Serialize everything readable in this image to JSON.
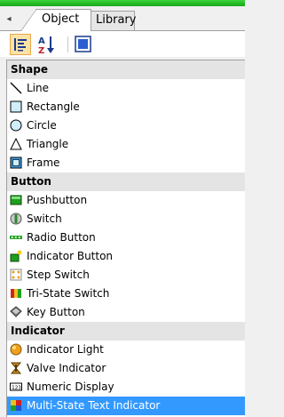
{
  "tabs": [
    {
      "label": "Object",
      "active": true
    },
    {
      "label": "Library",
      "active": false
    }
  ],
  "toolbar": {
    "categorized_icon": "categorized-sort-icon",
    "alphabetical_icon": "alphabetical-sort-icon",
    "properties_icon": "properties-icon"
  },
  "categories": [
    {
      "name": "Shape",
      "items": [
        "Line",
        "Rectangle",
        "Circle",
        "Triangle",
        "Frame"
      ]
    },
    {
      "name": "Button",
      "items": [
        "Pushbutton",
        "Switch",
        "Radio Button",
        "Indicator Button",
        "Step Switch",
        "Tri-State Switch",
        "Key Button"
      ]
    },
    {
      "name": "Indicator",
      "items": [
        "Indicator Light",
        "Valve Indicator",
        "Numeric Display",
        "Multi-State Text Indicator"
      ]
    }
  ],
  "selected_item": "Multi-State Text Indicator",
  "colors": {
    "accent_green": "#2fc42f",
    "selection": "#3399ff"
  }
}
